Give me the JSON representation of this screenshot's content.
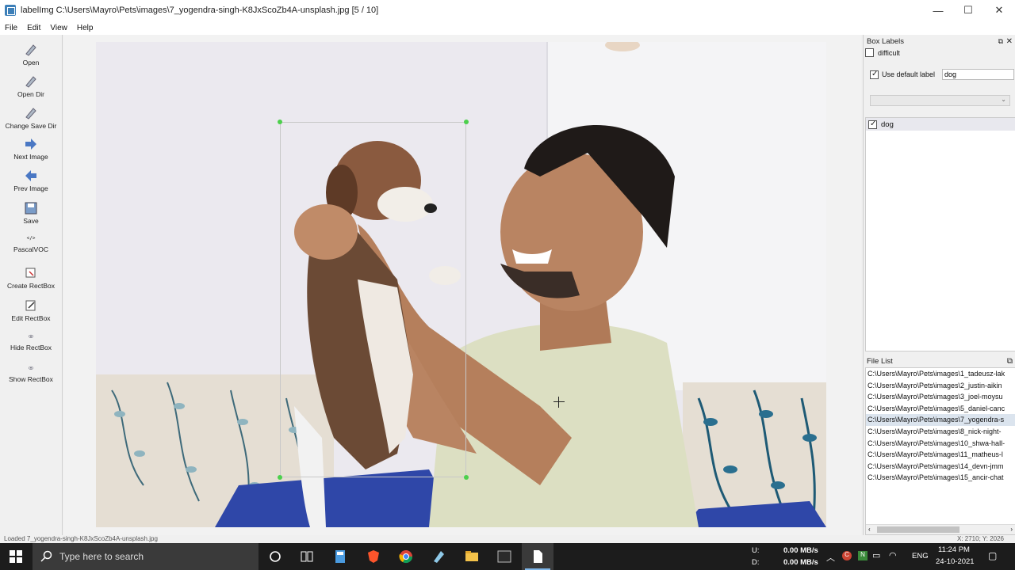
{
  "window": {
    "title": "labelImg C:\\Users\\Mayro\\Pets\\images\\7_yogendra-singh-K8JxScoZb4A-unsplash.jpg [5 / 10]",
    "minimize": "—",
    "maximize": "☐",
    "close": "✕"
  },
  "menu": [
    "File",
    "Edit",
    "View",
    "Help"
  ],
  "toolbar": [
    {
      "label": "Open",
      "icon": "open-icon"
    },
    {
      "label": "Open Dir",
      "icon": "open-dir-icon"
    },
    {
      "label": "Change Save Dir",
      "icon": "change-save-dir-icon"
    },
    {
      "label": "Next Image",
      "icon": "next-arrow-icon"
    },
    {
      "label": "Prev Image",
      "icon": "prev-arrow-icon"
    },
    {
      "label": "Save",
      "icon": "save-icon"
    },
    {
      "label": "PascalVOC",
      "icon": "code-icon"
    },
    {
      "label": "Create\nRectBox",
      "icon": "create-rect-icon"
    },
    {
      "label": "Edit RectBox",
      "icon": "edit-rect-icon"
    },
    {
      "label": "Hide RectBox",
      "icon": "eye-icon"
    },
    {
      "label": "Show RectBox",
      "icon": "eye-icon"
    }
  ],
  "box_labels": {
    "title": "Box Labels",
    "difficult_label": "difficult",
    "difficult_checked": false,
    "use_default_label": "Use default label",
    "use_default_checked": true,
    "default_label_value": "dog",
    "labels": [
      {
        "name": "dog",
        "checked": true
      }
    ]
  },
  "file_list": {
    "title": "File List",
    "items": [
      "C:\\Users\\Mayro\\Pets\\images\\1_tadeusz-lak",
      "C:\\Users\\Mayro\\Pets\\images\\2_justin-aikin",
      "C:\\Users\\Mayro\\Pets\\images\\3_joel-moysu",
      "C:\\Users\\Mayro\\Pets\\images\\5_daniel-canc",
      "C:\\Users\\Mayro\\Pets\\images\\7_yogendra-s",
      "C:\\Users\\Mayro\\Pets\\images\\8_nick-night-",
      "C:\\Users\\Mayro\\Pets\\images\\10_shwa-hall-",
      "C:\\Users\\Mayro\\Pets\\images\\11_matheus-l",
      "C:\\Users\\Mayro\\Pets\\images\\14_devn-jmm",
      "C:\\Users\\Mayro\\Pets\\images\\15_ancir-chat"
    ],
    "selected_index": 4
  },
  "status": {
    "message": "Loaded 7_yogendra-singh-K8JxScoZb4A-unsplash.jpg",
    "coords": "X: 2710; Y: 2026"
  },
  "taskbar": {
    "search_placeholder": "Type here to search",
    "net_up_label": "U:",
    "net_up": "0.00 MB/s",
    "net_down_label": "D:",
    "net_down": "0.00 MB/s",
    "lang": "ENG",
    "time": "11:24 PM",
    "date": "24-10-2021"
  }
}
